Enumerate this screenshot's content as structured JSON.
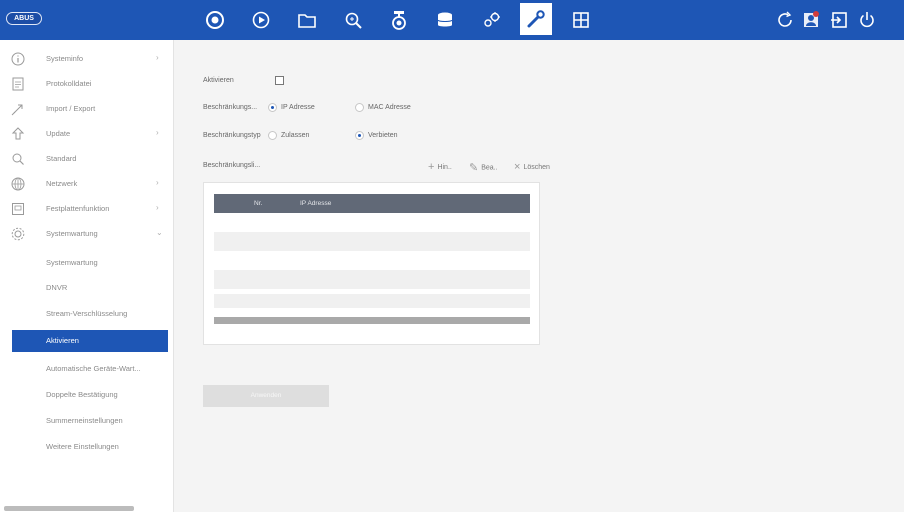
{
  "app": {
    "logo": "ABUS"
  },
  "topnav": {
    "items": [
      {
        "name": "live-view",
        "icon": "camera-icon"
      },
      {
        "name": "playback",
        "icon": "play-icon"
      },
      {
        "name": "files",
        "icon": "folder-icon"
      },
      {
        "name": "search",
        "icon": "search-icon"
      },
      {
        "name": "camera-setup",
        "icon": "dome-camera-icon"
      },
      {
        "name": "storage",
        "icon": "database-icon"
      },
      {
        "name": "configuration",
        "icon": "gears-icon"
      },
      {
        "name": "maintenance",
        "icon": "wrench-icon",
        "active": true
      },
      {
        "name": "layout",
        "icon": "grid-icon"
      }
    ],
    "right": [
      {
        "name": "refresh",
        "icon": "refresh-icon"
      },
      {
        "name": "user",
        "icon": "user-icon"
      },
      {
        "name": "logout",
        "icon": "logout-icon"
      },
      {
        "name": "power",
        "icon": "power-icon"
      }
    ]
  },
  "sidebar": {
    "items": [
      {
        "label": "Systeminfo",
        "icon": "info-icon",
        "chevron": "›"
      },
      {
        "label": "Protokolldatei",
        "icon": "document-icon"
      },
      {
        "label": "Import / Export",
        "icon": "import-export-icon"
      },
      {
        "label": "Update",
        "icon": "upload-icon",
        "chevron": "›"
      },
      {
        "label": "Standard",
        "icon": "reset-icon"
      },
      {
        "label": "Netzwerk",
        "icon": "network-icon",
        "chevron": "›"
      },
      {
        "label": "Festplattenfunktion",
        "icon": "hdd-icon",
        "chevron": "›"
      },
      {
        "label": "Systemwartung",
        "icon": "gear-icon",
        "chevron": "⌄"
      }
    ],
    "subitems": [
      {
        "label": "Systemwartung"
      },
      {
        "label": "DNVR"
      },
      {
        "label": "Stream-Verschlüsselung"
      },
      {
        "label": "Aktivieren",
        "active": true
      },
      {
        "label": "Automatische Geräte-Wart..."
      },
      {
        "label": "Doppelte Bestätigung"
      },
      {
        "label": "Summerneinstellungen"
      },
      {
        "label": "Weitere Einstellungen"
      }
    ]
  },
  "form": {
    "enable_label": "Aktivieren",
    "enable_checked": false,
    "type_label": "Beschränkungs...",
    "type_options": [
      "IP Adresse",
      "MAC Adresse"
    ],
    "type_selected": 0,
    "mode_label": "Beschränkungstyp",
    "mode_options": [
      "Zulassen",
      "Verbieten"
    ],
    "mode_selected": 1,
    "list_label": "Beschränkungsli...",
    "toolbar": {
      "add": "Hin..",
      "edit": "Bea..",
      "delete": "Löschen"
    },
    "table": {
      "columns": [
        "Nr.",
        "IP Adresse"
      ],
      "rows": []
    },
    "apply": "Anwenden"
  }
}
